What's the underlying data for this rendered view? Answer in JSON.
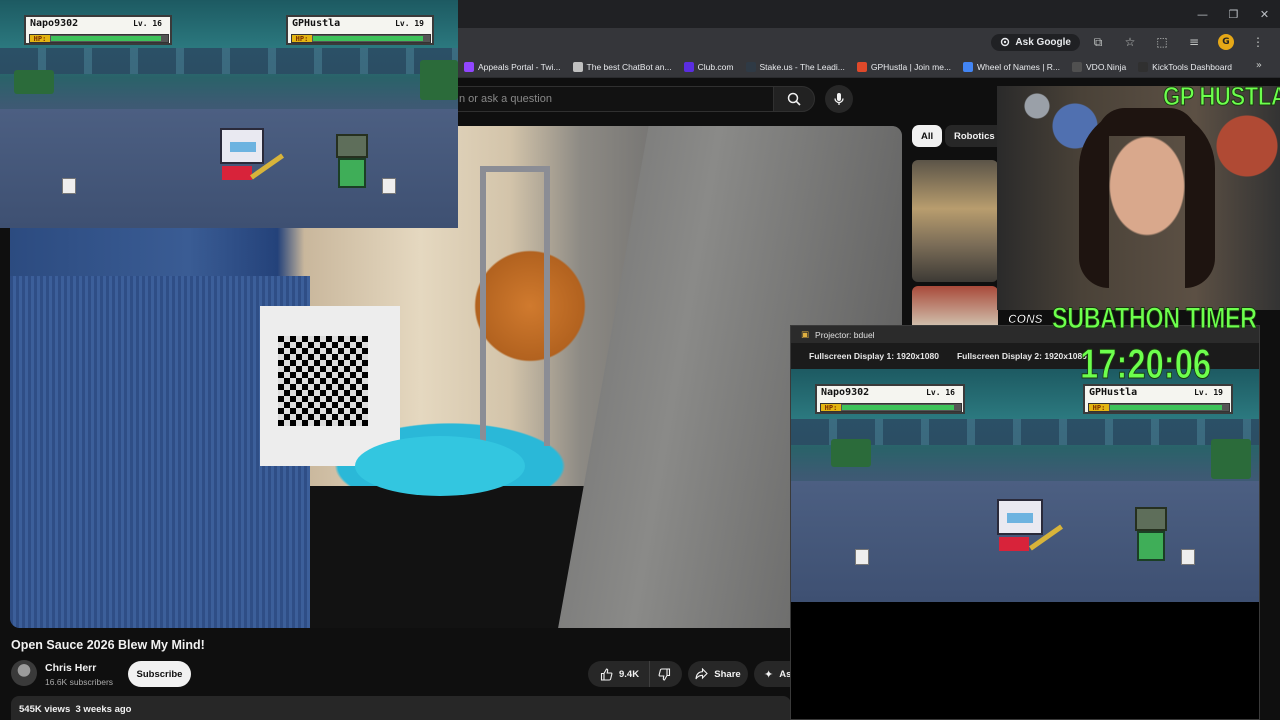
{
  "browser": {
    "ask_google": "Ask Google",
    "profile_initial": "G",
    "bookmarks": [
      {
        "label": "Appeals Portal - Twi...",
        "icon": "twitch-icon",
        "color": "#9146ff"
      },
      {
        "label": "The best ChatBot an...",
        "icon": "chatbot-icon",
        "color": "#c0c0c0"
      },
      {
        "label": "Club.com",
        "icon": "club-icon",
        "color": "#5a2de0"
      },
      {
        "label": "Stake.us - The Leadi...",
        "icon": "stake-icon",
        "color": "#2f3a45"
      },
      {
        "label": "GPHustla | Join me...",
        "icon": "gphustla-icon",
        "color": "#e0492a"
      },
      {
        "label": "Wheel of Names | R...",
        "icon": "wheel-icon",
        "color": "#4285f4"
      },
      {
        "label": "VDO.Ninja",
        "icon": "vdoninja-icon",
        "color": "#505050"
      },
      {
        "label": "KickTools Dashboard",
        "icon": "kicktools-icon",
        "color": "#303030"
      }
    ]
  },
  "youtube": {
    "search_placeholder": "n or ask a question",
    "video_title": "Open Sauce 2026 Blew My Mind!",
    "channel_name": "Chris Herr",
    "channel_subs": "16.6K subscribers",
    "subscribe_label": "Subscribe",
    "like_count": "9.4K",
    "share_label": "Share",
    "ask_label": "As",
    "meta": "545K views  3 weeks ago",
    "chips": [
      "All",
      "Robotics"
    ],
    "rec_thumb_text": "CONS"
  },
  "overlay": {
    "player1": {
      "name": "Napo9302",
      "level": "Lv. 16",
      "hp_label": "HP:",
      "hp_fraction": 0.95
    },
    "player2": {
      "name": "GPHustla",
      "level": "Lv. 19",
      "hp_label": "HP:",
      "hp_fraction": 0.95
    },
    "webcam_label": "GP HUSTLA",
    "subathon_label": "SUBATHON TIMER",
    "subathon_timer": "17:20:06"
  },
  "projector": {
    "title": "Projector: bduel",
    "menu": [
      "Fullscreen Display 1: 1920x1080",
      "Fullscreen Display 2: 1920x1080"
    ]
  },
  "colors": {
    "accent_green": "#6dff4d",
    "hp_green": "#3ec35a",
    "yt_bg": "#0f0f0f"
  }
}
